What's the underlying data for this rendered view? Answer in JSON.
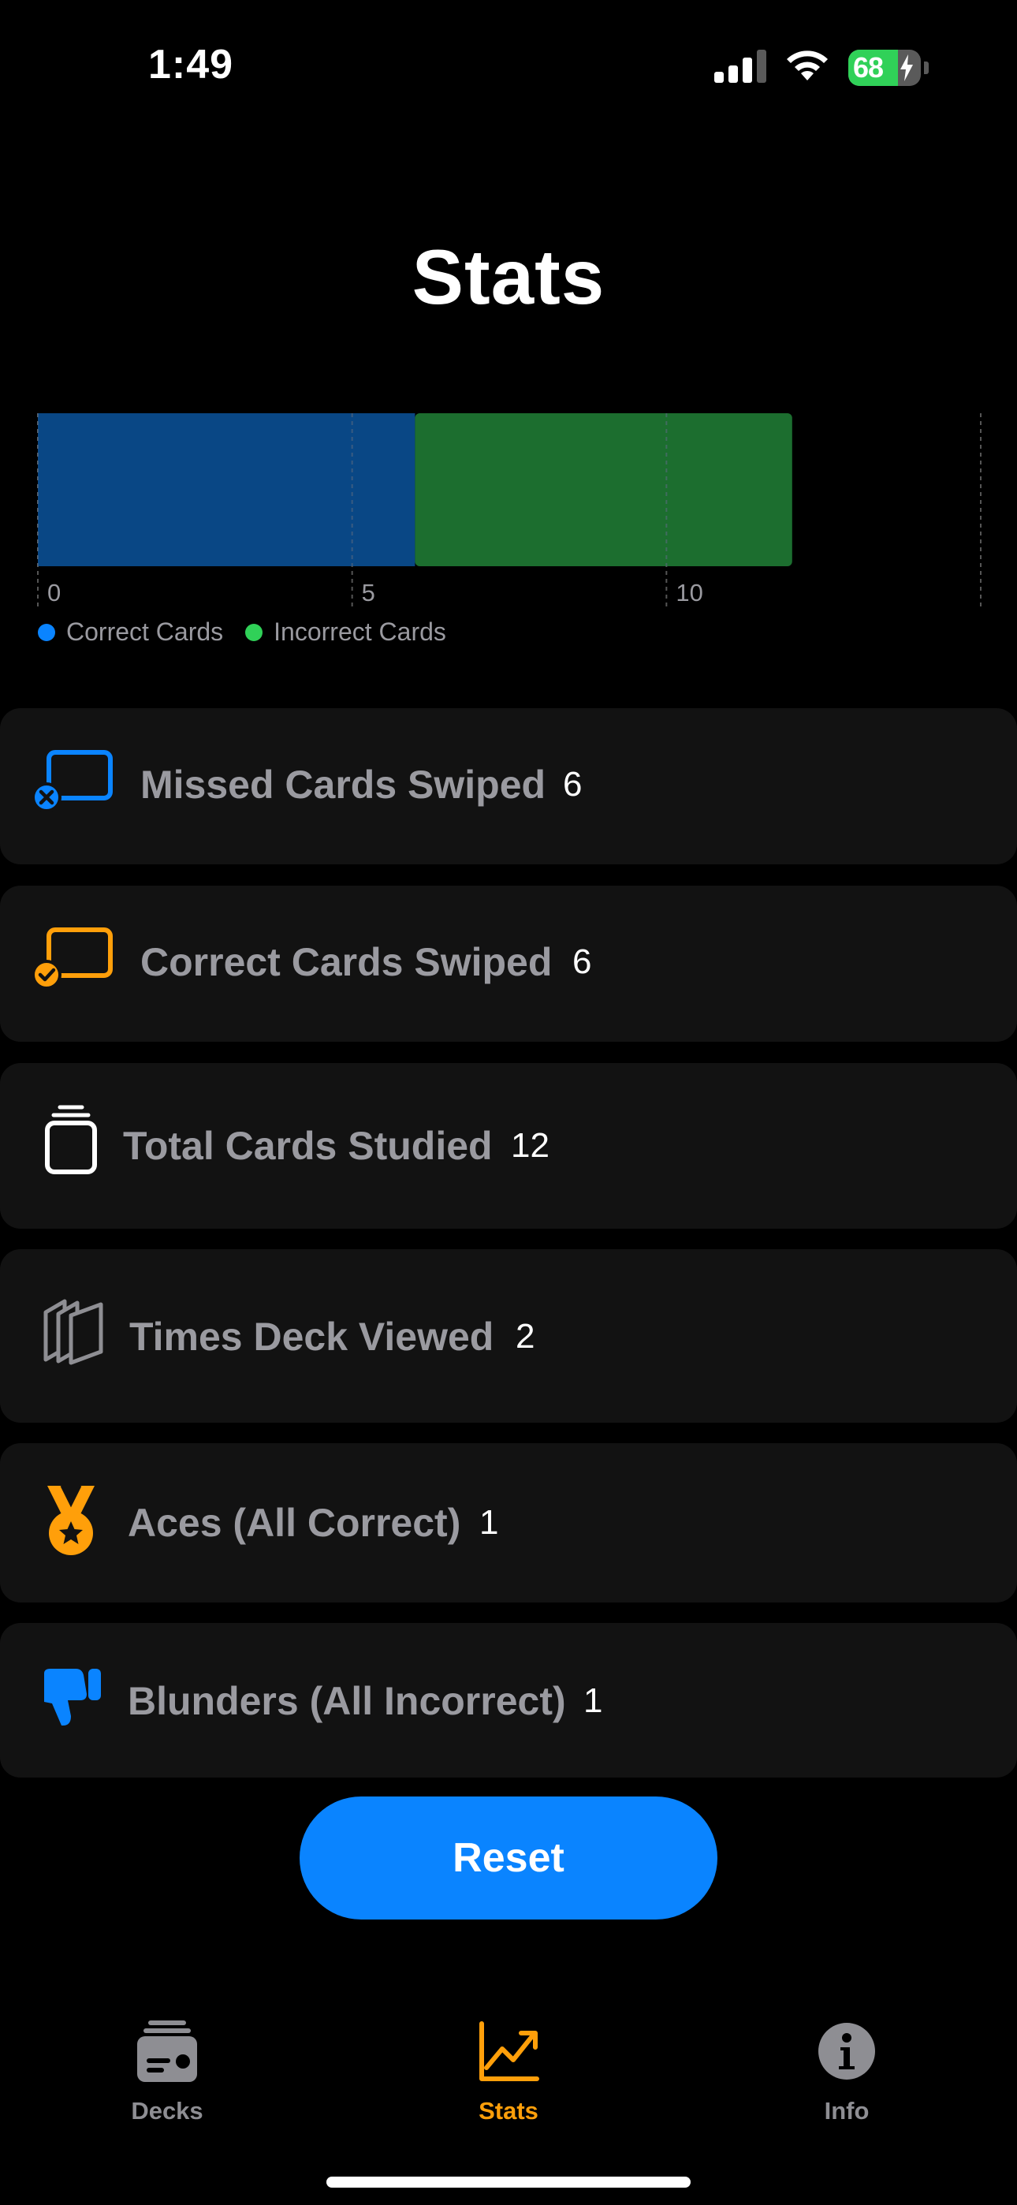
{
  "status_bar": {
    "time": "1:49",
    "battery_level": "68",
    "battery_fraction": 0.68,
    "icons": [
      "cellular-signal-icon",
      "wifi-icon",
      "battery-charging-icon"
    ]
  },
  "page": {
    "title": "Stats"
  },
  "chart_data": {
    "type": "bar",
    "orientation": "horizontal",
    "stacked": true,
    "categories": [
      ""
    ],
    "series": [
      {
        "name": "Correct Cards",
        "values": [
          6
        ],
        "color": "#094785"
      },
      {
        "name": "Incorrect Cards",
        "values": [
          6
        ],
        "color": "#1c6e2f"
      }
    ],
    "xlim": [
      0,
      15
    ],
    "xticks": [
      0,
      5,
      10
    ],
    "xtick_labels": [
      "0",
      "5",
      "10"
    ],
    "grid": true,
    "legend_position": "bottom-left",
    "legend": [
      {
        "label": "Correct Cards",
        "color": "#0a84ff"
      },
      {
        "label": "Incorrect Cards",
        "color": "#30d158"
      }
    ]
  },
  "stats": [
    {
      "label": "Missed Cards Swiped",
      "value": "6",
      "icon": "card-x-icon",
      "icon_color": "#0a84ff"
    },
    {
      "label": "Correct Cards Swiped",
      "value": "6",
      "icon": "card-check-icon",
      "icon_color": "#ff9f0a"
    },
    {
      "label": "Total Cards Studied",
      "value": "12",
      "icon": "card-stack-icon",
      "icon_color": "#ffffff"
    },
    {
      "label": "Times Deck Viewed",
      "value": "2",
      "icon": "stacked-cards-icon",
      "icon_color": "#8e8e93"
    },
    {
      "label": "Aces (All Correct)",
      "value": "1",
      "icon": "medal-icon",
      "icon_color": "#ff9f0a"
    },
    {
      "label": "Blunders (All Incorrect)",
      "value": "1",
      "icon": "thumbs-down-icon",
      "icon_color": "#0a84ff"
    }
  ],
  "reset_button": {
    "label": "Reset"
  },
  "tab_bar": {
    "tabs": [
      {
        "label": "Decks",
        "icon": "decks-icon",
        "active": false,
        "color": "#8e8e93"
      },
      {
        "label": "Stats",
        "icon": "chart-icon",
        "active": true,
        "color": "#ff9f0a"
      },
      {
        "label": "Info",
        "icon": "info-icon",
        "active": false,
        "color": "#8e8e93"
      }
    ]
  },
  "colors": {
    "background": "#000000",
    "row_background": "#121212",
    "accent_blue": "#0a84ff",
    "accent_orange": "#ff9f0a",
    "label_gray": "#9a9aa0"
  }
}
